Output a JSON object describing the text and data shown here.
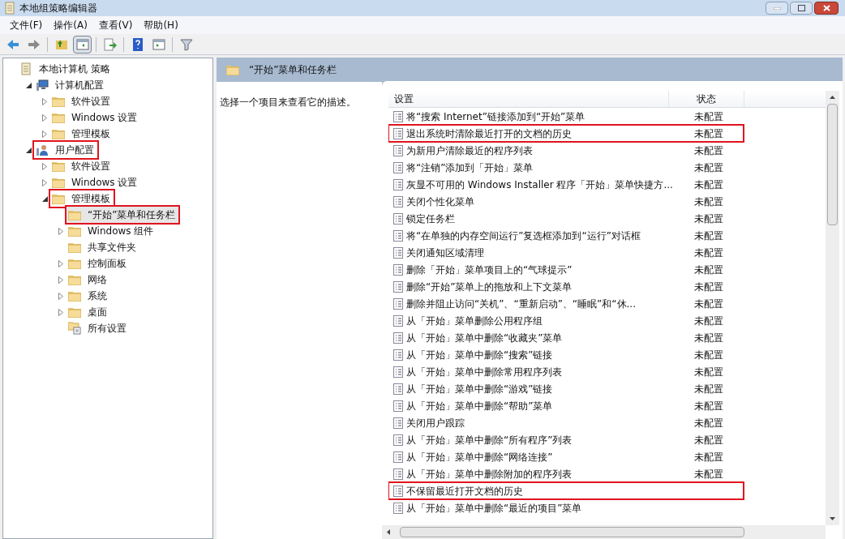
{
  "window": {
    "title": "本地组策略编辑器"
  },
  "menu": [
    "文件(F)",
    "操作(A)",
    "查看(V)",
    "帮助(H)"
  ],
  "toolbar": [
    {
      "kind": "back",
      "selected": false
    },
    {
      "kind": "forward",
      "selected": false
    },
    {
      "kind": "sep"
    },
    {
      "kind": "up",
      "selected": false
    },
    {
      "kind": "pane",
      "selected": true
    },
    {
      "kind": "sep"
    },
    {
      "kind": "export",
      "selected": false
    },
    {
      "kind": "sep"
    },
    {
      "kind": "help",
      "selected": false
    },
    {
      "kind": "view",
      "selected": false
    },
    {
      "kind": "sep"
    },
    {
      "kind": "filter",
      "selected": false
    }
  ],
  "tree": [
    {
      "label": "本地计算机 策略",
      "kind": "policy",
      "selected": false,
      "highlighted": false,
      "children": [
        {
          "label": "计算机配置",
          "kind": "computer",
          "expanded": true,
          "selected": false,
          "highlighted": false,
          "children": [
            {
              "label": "软件设置",
              "kind": "folder",
              "expanded": false,
              "selected": false,
              "highlighted": false
            },
            {
              "label": "Windows 设置",
              "kind": "folder",
              "expanded": false,
              "selected": false,
              "highlighted": false
            },
            {
              "label": "管理模板",
              "kind": "folder",
              "expanded": false,
              "selected": false,
              "highlighted": false
            }
          ]
        },
        {
          "label": "用户配置",
          "kind": "user",
          "expanded": true,
          "selected": false,
          "highlighted": true,
          "children": [
            {
              "label": "软件设置",
              "kind": "folder",
              "expanded": false,
              "selected": false,
              "highlighted": false
            },
            {
              "label": "Windows 设置",
              "kind": "folder",
              "expanded": false,
              "selected": false,
              "highlighted": false
            },
            {
              "label": "管理模板",
              "kind": "folder",
              "expanded": true,
              "selected": false,
              "highlighted": true,
              "children": [
                {
                  "label": "“开始”菜单和任务栏",
                  "kind": "folder",
                  "selected": true,
                  "highlighted": true
                },
                {
                  "label": "Windows 组件",
                  "kind": "folder",
                  "expanded": false,
                  "selected": false,
                  "highlighted": false
                },
                {
                  "label": "共享文件夹",
                  "kind": "folder",
                  "selected": false,
                  "highlighted": false
                },
                {
                  "label": "控制面板",
                  "kind": "folder",
                  "expanded": false,
                  "selected": false,
                  "highlighted": false
                },
                {
                  "label": "网络",
                  "kind": "folder",
                  "expanded": false,
                  "selected": false,
                  "highlighted": false
                },
                {
                  "label": "系统",
                  "kind": "folder",
                  "expanded": false,
                  "selected": false,
                  "highlighted": false
                },
                {
                  "label": "桌面",
                  "kind": "folder",
                  "expanded": false,
                  "selected": false,
                  "highlighted": false
                },
                {
                  "label": "所有设置",
                  "kind": "all",
                  "selected": false,
                  "highlighted": false
                }
              ]
            }
          ]
        }
      ]
    }
  ],
  "details": {
    "header": "“开始”菜单和任务栏",
    "description": "选择一个项目来查看它的描述。",
    "columns": [
      "设置",
      "状态"
    ],
    "rows": [
      {
        "name": "将“搜索 Internet”链接添加到“开始”菜单",
        "state": "未配置",
        "highlighted": false
      },
      {
        "name": "退出系统时清除最近打开的文档的历史",
        "state": "未配置",
        "highlighted": true
      },
      {
        "name": "为新用户清除最近的程序列表",
        "state": "未配置",
        "highlighted": false
      },
      {
        "name": "将“注销”添加到「开始」菜单",
        "state": "未配置",
        "highlighted": false
      },
      {
        "name": "灰显不可用的 Windows Installer 程序「开始」菜单快捷方...",
        "state": "未配置",
        "highlighted": false
      },
      {
        "name": "关闭个性化菜单",
        "state": "未配置",
        "highlighted": false
      },
      {
        "name": "锁定任务栏",
        "state": "未配置",
        "highlighted": false
      },
      {
        "name": "将“在单独的内存空间运行”复选框添加到“运行”对话框",
        "state": "未配置",
        "highlighted": false
      },
      {
        "name": "关闭通知区域清理",
        "state": "未配置",
        "highlighted": false
      },
      {
        "name": "删除「开始」菜单项目上的“气球提示”",
        "state": "未配置",
        "highlighted": false
      },
      {
        "name": "删除“开始”菜单上的拖放和上下文菜单",
        "state": "未配置",
        "highlighted": false
      },
      {
        "name": "删除并阻止访问“关机”、“重新启动”、“睡眠”和“休...",
        "state": "未配置",
        "highlighted": false
      },
      {
        "name": "从「开始」菜单删除公用程序组",
        "state": "未配置",
        "highlighted": false
      },
      {
        "name": "从「开始」菜单中删除“收藏夹”菜单",
        "state": "未配置",
        "highlighted": false
      },
      {
        "name": "从「开始」菜单中删除“搜索”链接",
        "state": "未配置",
        "highlighted": false
      },
      {
        "name": "从「开始」菜单中删除常用程序列表",
        "state": "未配置",
        "highlighted": false
      },
      {
        "name": "从「开始」菜单中删除“游戏”链接",
        "state": "未配置",
        "highlighted": false
      },
      {
        "name": "从「开始」菜单中删除“帮助”菜单",
        "state": "未配置",
        "highlighted": false
      },
      {
        "name": "关闭用户跟踪",
        "state": "未配置",
        "highlighted": false
      },
      {
        "name": "从「开始」菜单中删除“所有程序”列表",
        "state": "未配置",
        "highlighted": false
      },
      {
        "name": "从「开始」菜单中删除“网络连接”",
        "state": "未配置",
        "highlighted": false
      },
      {
        "name": "从「开始」菜单中删除附加的程序列表",
        "state": "未配置",
        "highlighted": false
      },
      {
        "name": "不保留最近打开文档的历史",
        "highlighted": true
      },
      {
        "name": "从「开始」菜单中删除“最近的项目”菜单",
        "highlighted": false
      }
    ]
  }
}
